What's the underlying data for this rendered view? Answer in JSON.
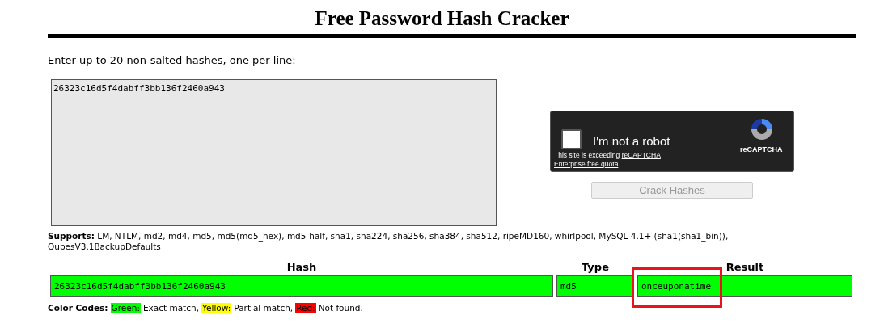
{
  "title": "Free Password Hash Cracker",
  "prompt": "Enter up to 20 non-salted hashes, one per line:",
  "hash_input": {
    "value": "26323c16d5f4dabff3bb136f2460a943"
  },
  "captcha": {
    "label": "I'm not a robot",
    "checked": false,
    "notice": "This site is exceeding ",
    "notice_link": "reCAPTCHA",
    "notice_link_2": "Enterprise free quota",
    "notice_end": ".",
    "brand": "reCAPTCHA"
  },
  "crack_button": {
    "label": "Crack Hashes",
    "disabled": true
  },
  "supports": {
    "label": "Supports:",
    "text": "LM, NTLM, md2, md4, md5, md5(md5_hex), md5-half, sha1, sha224, sha256, sha384, sha512, ripeMD160, whirlpool, MySQL 4.1+ (sha1(sha1_bin)), QubesV3.1BackupDefaults"
  },
  "table": {
    "columns": [
      "Hash",
      "Type",
      "Result"
    ],
    "rows": [
      {
        "hash": "26323c16d5f4dabff3bb136f2460a943",
        "type": "md5",
        "result": "onceuponatime",
        "color": "#00ff00",
        "result_highlighted": true
      }
    ]
  },
  "color_codes": {
    "label": "Color Codes:",
    "items": [
      {
        "name": "Green:",
        "meaning": "Exact match,",
        "color": "#00ff00"
      },
      {
        "name": "Yellow:",
        "meaning": "Partial match,",
        "color": "#ffff00"
      },
      {
        "name": "Red:",
        "meaning": "Not found.",
        "color": "#ff0000"
      }
    ]
  }
}
